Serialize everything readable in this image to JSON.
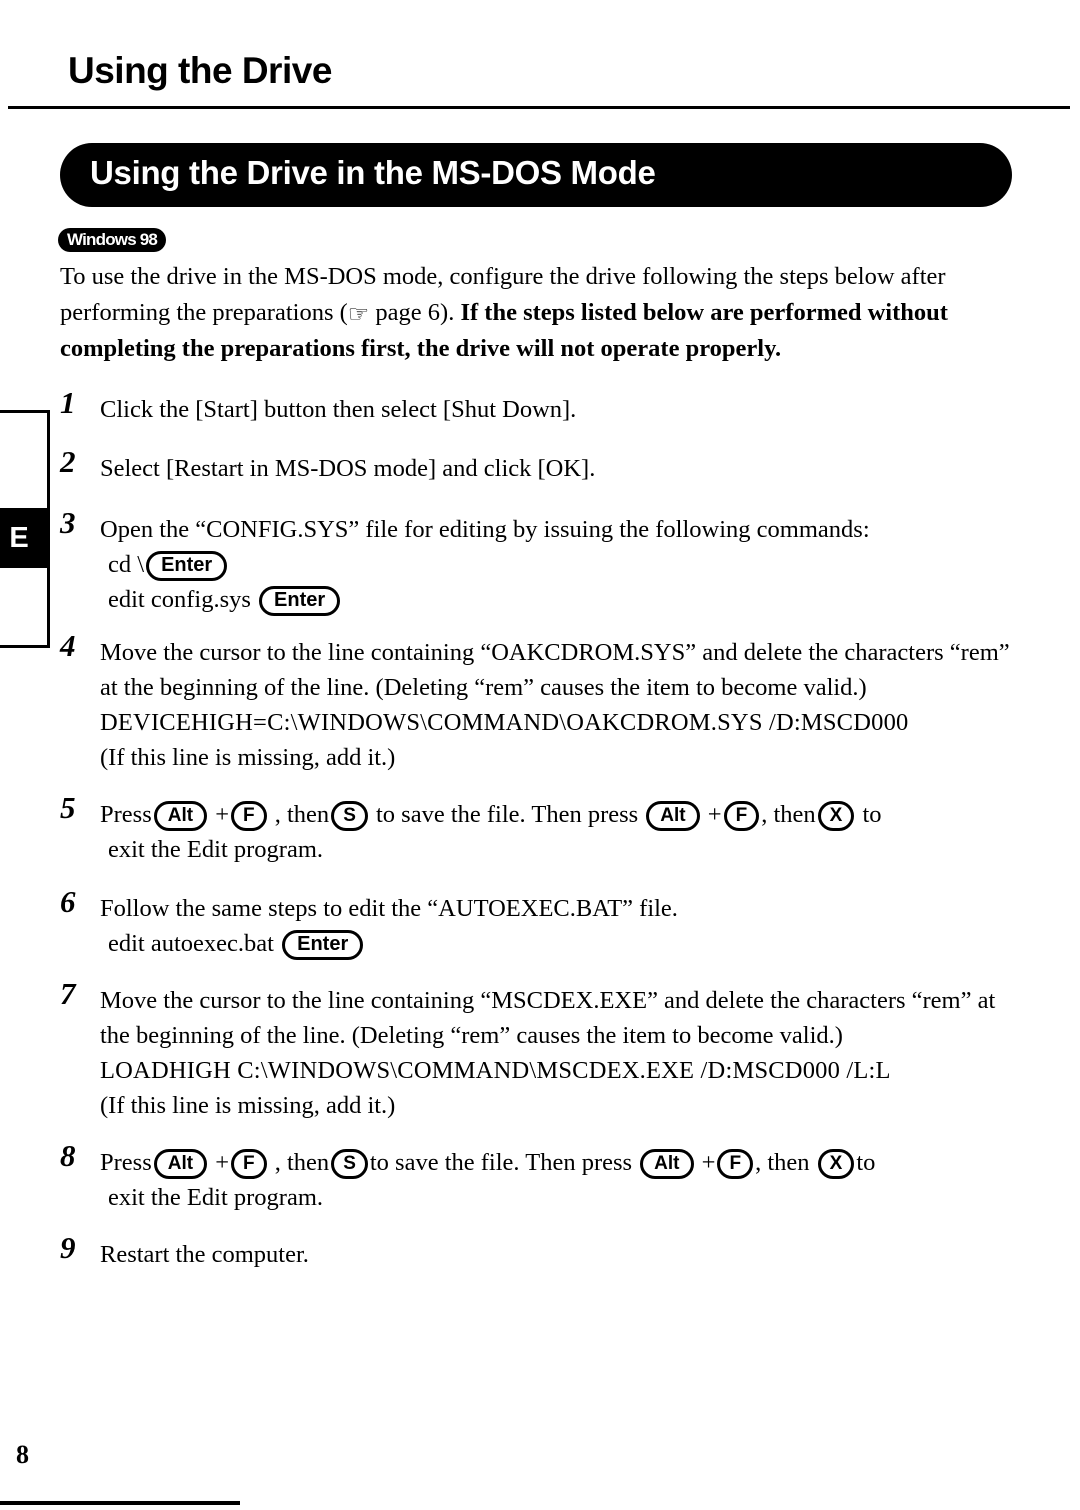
{
  "page": {
    "title": "Using the Drive",
    "number": "8",
    "edge_tab_letter": "E"
  },
  "section": {
    "banner_title": "Using the Drive in the MS-DOS Mode",
    "os_badge": "Windows 98"
  },
  "intro": {
    "text_part1": "To use the drive in the MS-DOS mode, configure the drive following the steps below after performing the preparations (",
    "hand_icon": "☞",
    "text_part2": " page 6).  ",
    "bold_text": "If the steps listed below are performed without completing the preparations first, the drive will not operate properly."
  },
  "keys": {
    "enter": "Enter",
    "alt": "Alt",
    "f": "F",
    "s": "S",
    "x": "X"
  },
  "steps": [
    {
      "number": "1",
      "lines": [
        "Click the [Start] button then select [Shut Down]."
      ]
    },
    {
      "number": "2",
      "lines": [
        "Select [Restart in MS-DOS mode] and click [OK]."
      ]
    },
    {
      "number": "3",
      "lines": [
        "Open the “CONFIG.SYS” file for editing by issuing the following commands:",
        "cd \\",
        "edit config.sys"
      ]
    },
    {
      "number": "4",
      "lines": [
        "Move the cursor to the line containing “OAKCDROM.SYS” and delete the characters “rem” at the beginning of the line. (Deleting “rem” causes the item to become valid.)",
        "DEVICEHIGH=C:\\WINDOWS\\COMMAND\\OAKCDROM.SYS /D:MSCD000",
        "(If this line is missing, add it.)"
      ]
    },
    {
      "number": "5",
      "lines": [
        "Press",
        "+",
        ", then",
        "to save the file.  Then press",
        "+",
        ", then",
        "to",
        "exit the Edit program."
      ]
    },
    {
      "number": "6",
      "lines": [
        "Follow the same steps to edit the “AUTOEXEC.BAT” file.",
        "edit autoexec.bat"
      ]
    },
    {
      "number": "7",
      "lines": [
        "Move the cursor to the line containing “MSCDEX.EXE” and delete the characters “rem” at the beginning of the line. (Deleting “rem” causes the item to become valid.)",
        "LOADHIGH  C:\\WINDOWS\\COMMAND\\MSCDEX.EXE /D:MSCD000 /L:L",
        "(If this line is missing, add it.)"
      ]
    },
    {
      "number": "8",
      "lines": [
        "Press",
        "+",
        ", then",
        "to save the file.  Then press",
        "+",
        ", then",
        "to",
        "exit the Edit program."
      ]
    },
    {
      "number": "9",
      "lines": [
        "Restart the computer."
      ]
    }
  ]
}
